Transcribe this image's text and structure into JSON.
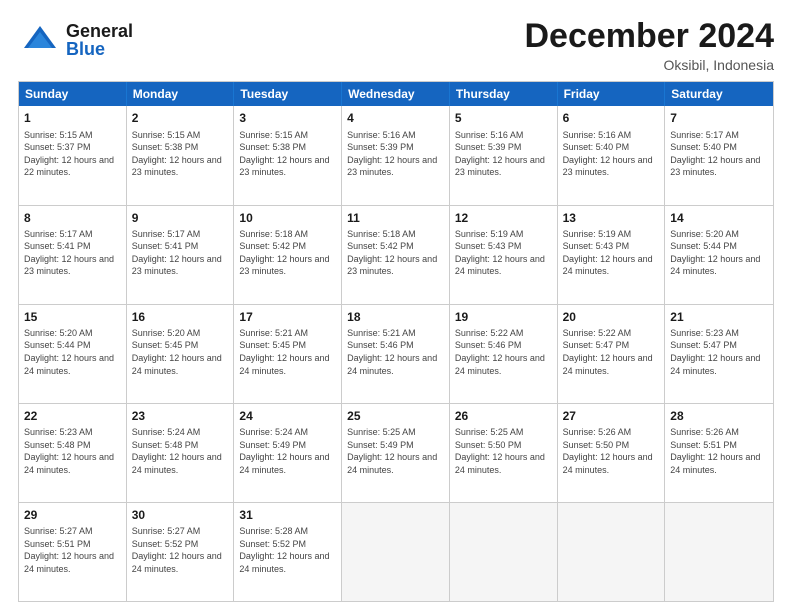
{
  "header": {
    "logo": {
      "general": "General",
      "blue": "Blue"
    },
    "title": "December 2024",
    "location": "Oksibil, Indonesia"
  },
  "calendar": {
    "days": [
      "Sunday",
      "Monday",
      "Tuesday",
      "Wednesday",
      "Thursday",
      "Friday",
      "Saturday"
    ],
    "rows": [
      [
        {
          "day": "1",
          "sunrise": "5:15 AM",
          "sunset": "5:37 PM",
          "daylight": "12 hours and 22 minutes."
        },
        {
          "day": "2",
          "sunrise": "5:15 AM",
          "sunset": "5:38 PM",
          "daylight": "12 hours and 23 minutes."
        },
        {
          "day": "3",
          "sunrise": "5:15 AM",
          "sunset": "5:38 PM",
          "daylight": "12 hours and 23 minutes."
        },
        {
          "day": "4",
          "sunrise": "5:16 AM",
          "sunset": "5:39 PM",
          "daylight": "12 hours and 23 minutes."
        },
        {
          "day": "5",
          "sunrise": "5:16 AM",
          "sunset": "5:39 PM",
          "daylight": "12 hours and 23 minutes."
        },
        {
          "day": "6",
          "sunrise": "5:16 AM",
          "sunset": "5:40 PM",
          "daylight": "12 hours and 23 minutes."
        },
        {
          "day": "7",
          "sunrise": "5:17 AM",
          "sunset": "5:40 PM",
          "daylight": "12 hours and 23 minutes."
        }
      ],
      [
        {
          "day": "8",
          "sunrise": "5:17 AM",
          "sunset": "5:41 PM",
          "daylight": "12 hours and 23 minutes."
        },
        {
          "day": "9",
          "sunrise": "5:17 AM",
          "sunset": "5:41 PM",
          "daylight": "12 hours and 23 minutes."
        },
        {
          "day": "10",
          "sunrise": "5:18 AM",
          "sunset": "5:42 PM",
          "daylight": "12 hours and 23 minutes."
        },
        {
          "day": "11",
          "sunrise": "5:18 AM",
          "sunset": "5:42 PM",
          "daylight": "12 hours and 23 minutes."
        },
        {
          "day": "12",
          "sunrise": "5:19 AM",
          "sunset": "5:43 PM",
          "daylight": "12 hours and 24 minutes."
        },
        {
          "day": "13",
          "sunrise": "5:19 AM",
          "sunset": "5:43 PM",
          "daylight": "12 hours and 24 minutes."
        },
        {
          "day": "14",
          "sunrise": "5:20 AM",
          "sunset": "5:44 PM",
          "daylight": "12 hours and 24 minutes."
        }
      ],
      [
        {
          "day": "15",
          "sunrise": "5:20 AM",
          "sunset": "5:44 PM",
          "daylight": "12 hours and 24 minutes."
        },
        {
          "day": "16",
          "sunrise": "5:20 AM",
          "sunset": "5:45 PM",
          "daylight": "12 hours and 24 minutes."
        },
        {
          "day": "17",
          "sunrise": "5:21 AM",
          "sunset": "5:45 PM",
          "daylight": "12 hours and 24 minutes."
        },
        {
          "day": "18",
          "sunrise": "5:21 AM",
          "sunset": "5:46 PM",
          "daylight": "12 hours and 24 minutes."
        },
        {
          "day": "19",
          "sunrise": "5:22 AM",
          "sunset": "5:46 PM",
          "daylight": "12 hours and 24 minutes."
        },
        {
          "day": "20",
          "sunrise": "5:22 AM",
          "sunset": "5:47 PM",
          "daylight": "12 hours and 24 minutes."
        },
        {
          "day": "21",
          "sunrise": "5:23 AM",
          "sunset": "5:47 PM",
          "daylight": "12 hours and 24 minutes."
        }
      ],
      [
        {
          "day": "22",
          "sunrise": "5:23 AM",
          "sunset": "5:48 PM",
          "daylight": "12 hours and 24 minutes."
        },
        {
          "day": "23",
          "sunrise": "5:24 AM",
          "sunset": "5:48 PM",
          "daylight": "12 hours and 24 minutes."
        },
        {
          "day": "24",
          "sunrise": "5:24 AM",
          "sunset": "5:49 PM",
          "daylight": "12 hours and 24 minutes."
        },
        {
          "day": "25",
          "sunrise": "5:25 AM",
          "sunset": "5:49 PM",
          "daylight": "12 hours and 24 minutes."
        },
        {
          "day": "26",
          "sunrise": "5:25 AM",
          "sunset": "5:50 PM",
          "daylight": "12 hours and 24 minutes."
        },
        {
          "day": "27",
          "sunrise": "5:26 AM",
          "sunset": "5:50 PM",
          "daylight": "12 hours and 24 minutes."
        },
        {
          "day": "28",
          "sunrise": "5:26 AM",
          "sunset": "5:51 PM",
          "daylight": "12 hours and 24 minutes."
        }
      ],
      [
        {
          "day": "29",
          "sunrise": "5:27 AM",
          "sunset": "5:51 PM",
          "daylight": "12 hours and 24 minutes."
        },
        {
          "day": "30",
          "sunrise": "5:27 AM",
          "sunset": "5:52 PM",
          "daylight": "12 hours and 24 minutes."
        },
        {
          "day": "31",
          "sunrise": "5:28 AM",
          "sunset": "5:52 PM",
          "daylight": "12 hours and 24 minutes."
        },
        null,
        null,
        null,
        null
      ]
    ]
  }
}
